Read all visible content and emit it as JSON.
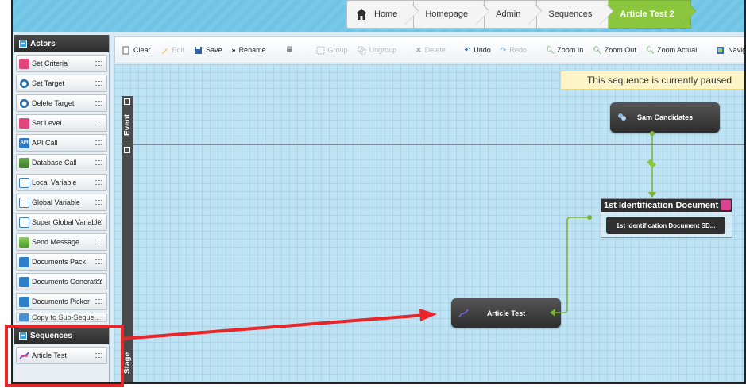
{
  "breadcrumb": {
    "items": [
      "Home",
      "Homepage",
      "Admin",
      "Sequences",
      "Article Test 2"
    ]
  },
  "sidebar": {
    "actors_heading": "Actors",
    "actors": [
      {
        "label": "Set Criteria",
        "icon": "criteria-icon"
      },
      {
        "label": "Set Target",
        "icon": "target-icon"
      },
      {
        "label": "Delete Target",
        "icon": "delete-target-icon"
      },
      {
        "label": "Set Level",
        "icon": "level-icon"
      },
      {
        "label": "API Call",
        "icon": "api-icon"
      },
      {
        "label": "Database Call",
        "icon": "database-icon"
      },
      {
        "label": "Local Variable",
        "icon": "local-variable-icon"
      },
      {
        "label": "Global Variable",
        "icon": "global-variable-icon"
      },
      {
        "label": "Super Global Variable",
        "icon": "super-global-variable-icon"
      },
      {
        "label": "Send Message",
        "icon": "send-message-icon"
      },
      {
        "label": "Documents Pack",
        "icon": "documents-pack-icon"
      },
      {
        "label": "Documents Generator",
        "icon": "documents-generator-icon"
      },
      {
        "label": "Documents Picker",
        "icon": "documents-picker-icon"
      },
      {
        "label": "Copy to Sub-Seque...",
        "icon": "copy-icon"
      }
    ],
    "sequences_heading": "Sequences",
    "sequences": [
      {
        "label": "Article Test",
        "icon": "sequence-icon"
      }
    ]
  },
  "toolbar": {
    "clear": "Clear",
    "edit": "Edit",
    "save": "Save",
    "rename": "Rename",
    "group": "Group",
    "ungroup": "Ungroup",
    "delete": "Delete",
    "undo": "Undo",
    "redo": "Redo",
    "zoom_in": "Zoom In",
    "zoom_out": "Zoom Out",
    "zoom_actual": "Zoom Actual",
    "navigate": "Naviga"
  },
  "canvas": {
    "paused_notice": "This sequence is currently paused",
    "lane_event": "Event",
    "lane_stage": "Stage",
    "nodes": {
      "sam_candidates": "Sam Candidates",
      "group_title": "1st Identification Document ...",
      "group_child": "1st Identification Document SD...",
      "article_test": "Article Test"
    }
  },
  "colors": {
    "accent_green": "#8cc63f",
    "highlight_red": "#e8262a",
    "connector_green": "#7fb23a"
  }
}
